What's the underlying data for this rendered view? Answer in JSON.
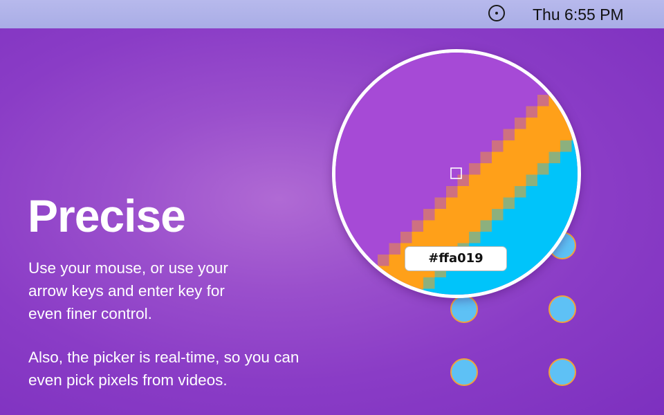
{
  "menubar": {
    "status_icon": "circle-dot-icon",
    "clock": "Thu 6:55 PM"
  },
  "content": {
    "title": "Precise",
    "paragraph1": "Use your mouse, or use your\narrow keys and enter key for\neven finer control.",
    "paragraph2": "Also, the picker is real-time, so you can\neven pick pixels from videos."
  },
  "magnifier": {
    "color_hex": "#ffa019",
    "colors": {
      "purple": "#a64ad6",
      "orange": "#ffa019",
      "cyan": "#00c4fa",
      "border": "#ffffff"
    }
  },
  "colors": {
    "background": "#8c3ec8",
    "menubar": "#b3b6ea",
    "dot_fill": "#5ec1f5",
    "dot_border": "#f2a23a"
  }
}
